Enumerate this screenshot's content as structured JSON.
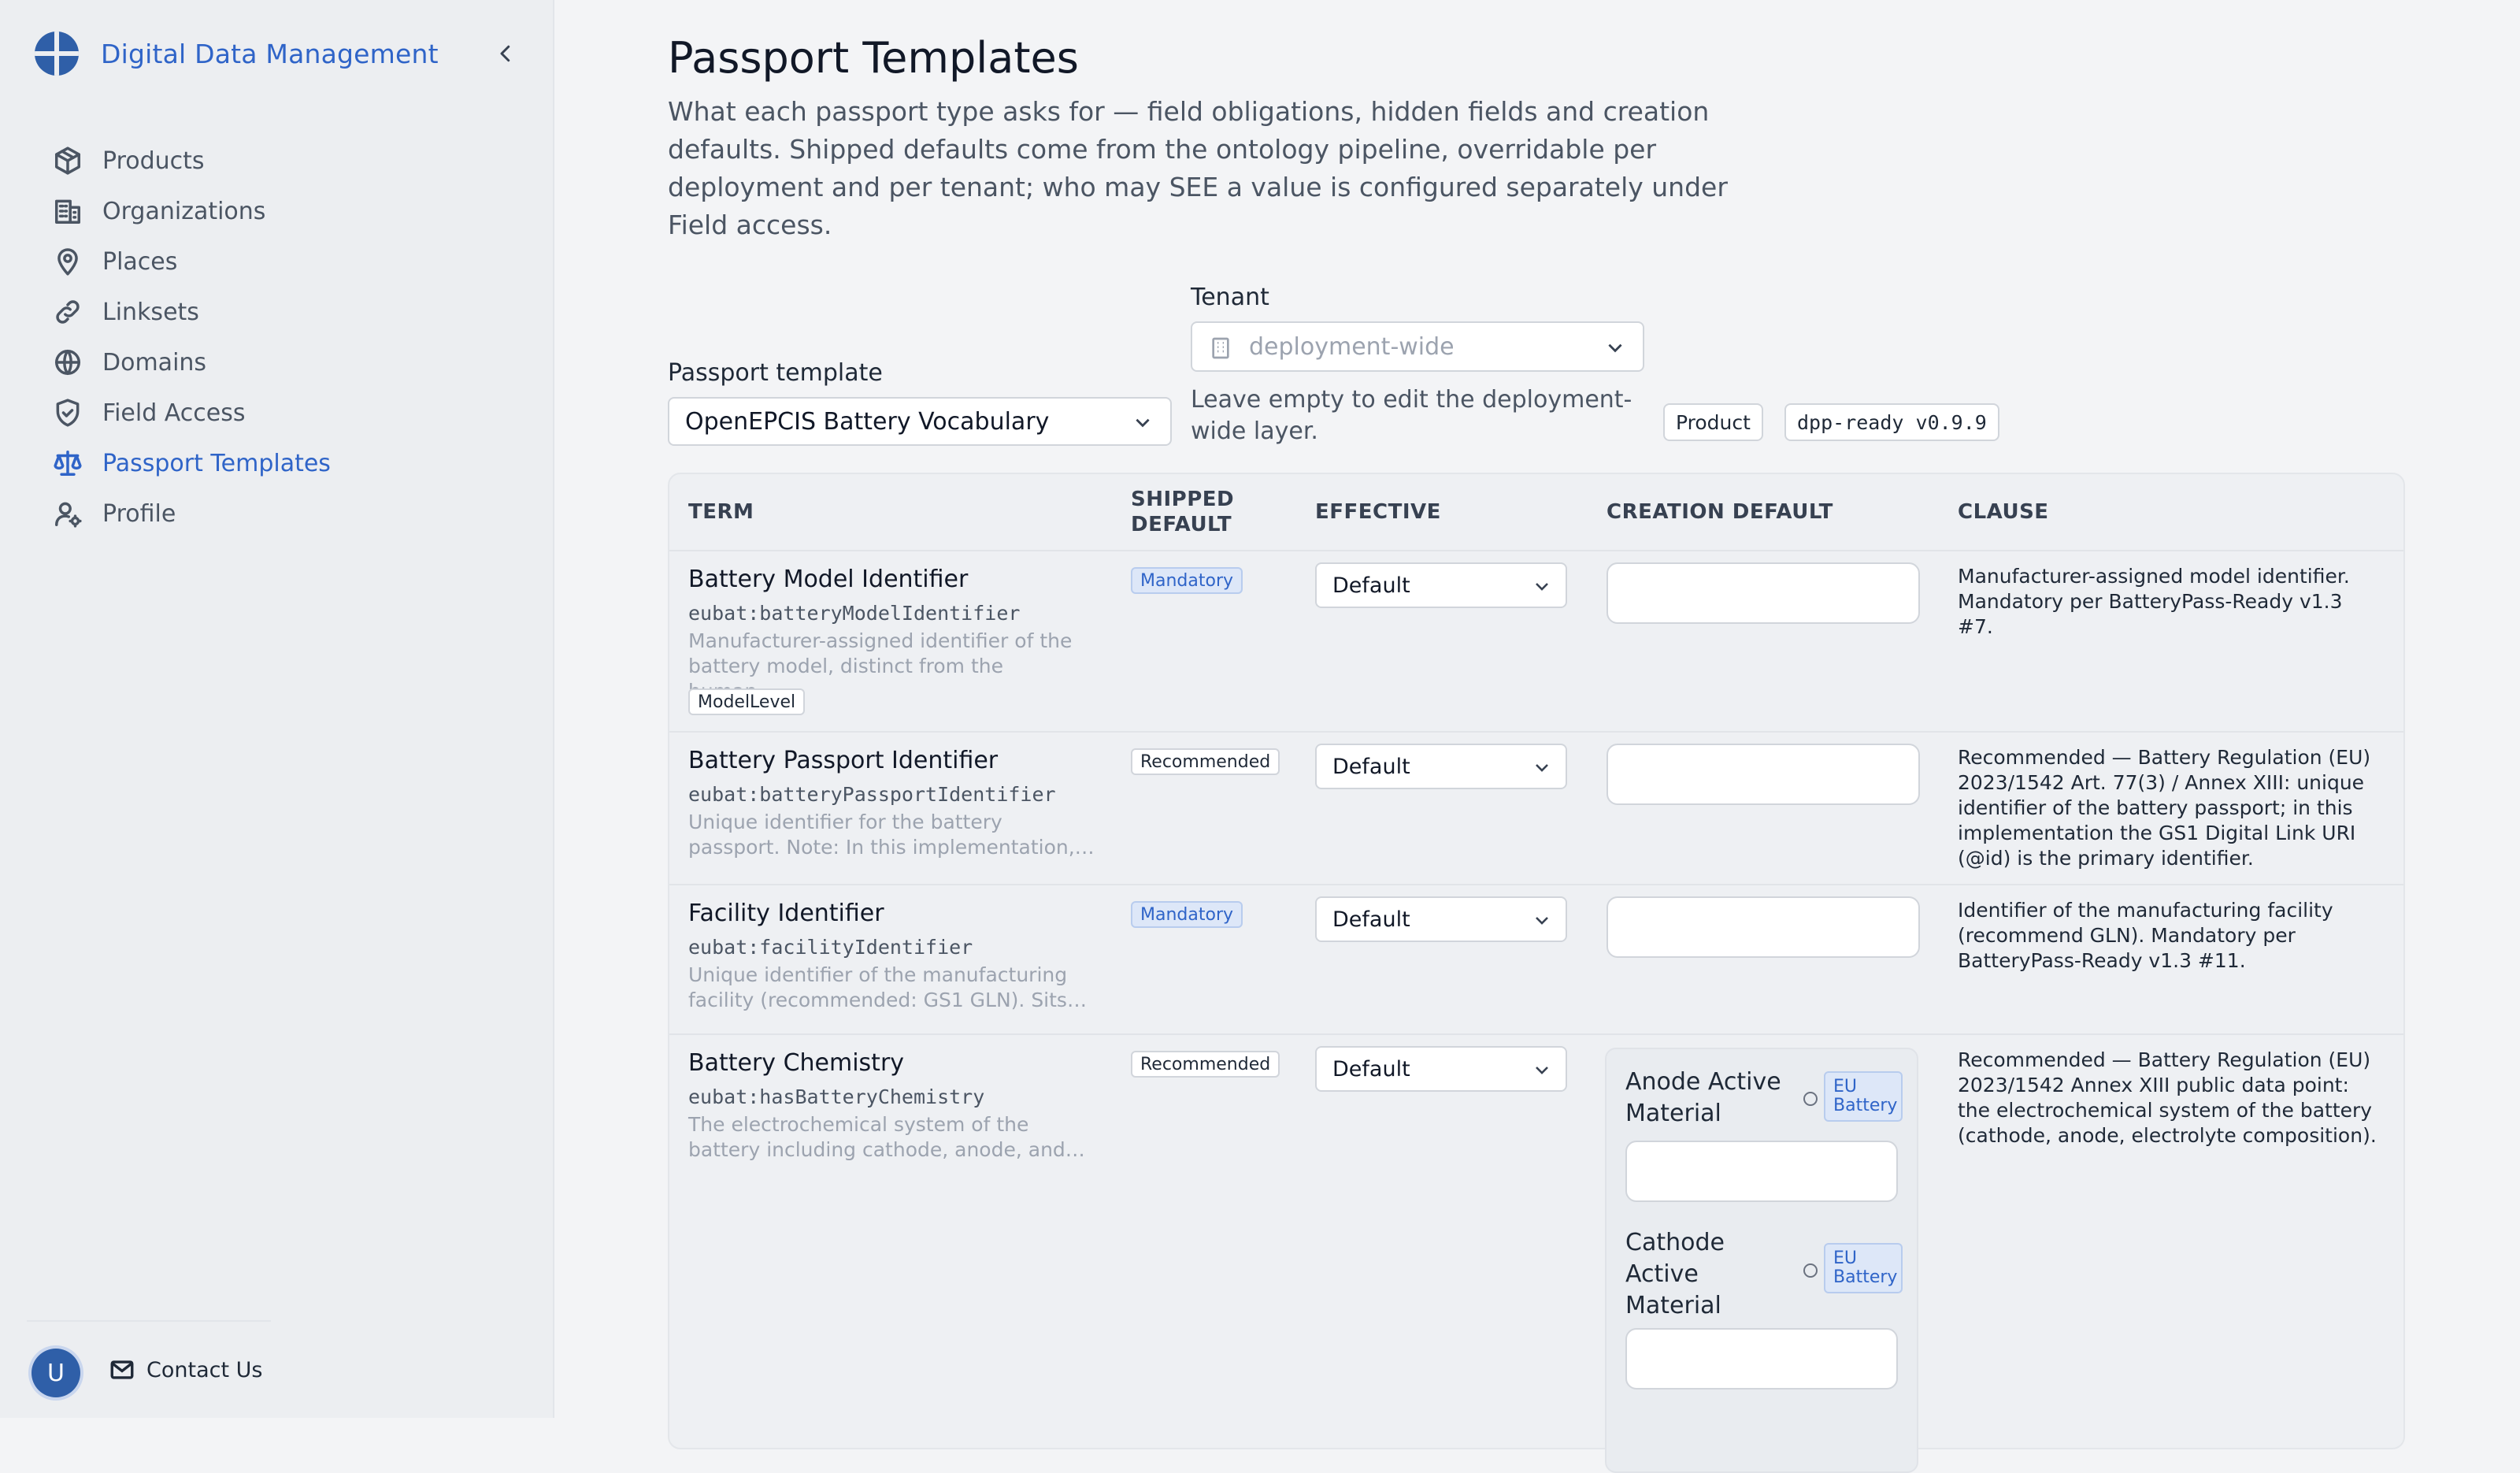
{
  "app": {
    "title": "Digital Data Management"
  },
  "sidebar": {
    "items": [
      {
        "label": "Products",
        "icon": "box-icon"
      },
      {
        "label": "Organizations",
        "icon": "building-icon"
      },
      {
        "label": "Places",
        "icon": "map-pin-icon"
      },
      {
        "label": "Linksets",
        "icon": "link-icon"
      },
      {
        "label": "Domains",
        "icon": "globe-icon"
      },
      {
        "label": "Field Access",
        "icon": "shield-icon"
      },
      {
        "label": "Passport Templates",
        "icon": "scale-icon",
        "active": true
      },
      {
        "label": "Profile",
        "icon": "user-gear-icon"
      }
    ],
    "avatar_initial": "U",
    "contact_label": "Contact Us"
  },
  "page": {
    "title": "Passport Templates",
    "description": "What each passport type asks for — field obligations, hidden fields and creation defaults. Shipped defaults come from the ontology pipeline, overridable per deployment and per tenant; who may SEE a value is configured separately under Field access."
  },
  "filters": {
    "template_label": "Passport template",
    "template_value": "OpenEPCIS Battery Vocabulary",
    "tenant_label": "Tenant",
    "tenant_placeholder": "deployment-wide",
    "tenant_help": "Leave empty to edit the deployment-wide layer.",
    "badge_product": "Product",
    "badge_version": "dpp-ready v0.9.9"
  },
  "table": {
    "headers": {
      "term": "TERM",
      "shipped": "SHIPPED DEFAULT",
      "effective": "EFFECTIVE",
      "creation": "CREATION DEFAULT",
      "clause": "CLAUSE"
    },
    "rows": [
      {
        "name": "Battery Model Identifier",
        "id": "eubat:batteryModelIdentifier",
        "desc": "Manufacturer-assigned identifier of the battery model, distinct from the human…",
        "level_tag": "ModelLevel",
        "shipped": "Mandatory",
        "effective": "Default",
        "clause": "Manufacturer-assigned model identifier. Mandatory per BatteryPass-Ready v1.3 #7."
      },
      {
        "name": "Battery Passport Identifier",
        "id": "eubat:batteryPassportIdentifier",
        "desc": "Unique identifier for the battery passport. Note: In this implementation,…",
        "shipped": "Recommended",
        "effective": "Default",
        "clause": "Recommended — Battery Regulation (EU) 2023/1542 Art. 77(3) / Annex XIII: unique identifier of the battery passport; in this implementation the GS1 Digital Link URI (@id) is the primary identifier."
      },
      {
        "name": "Facility Identifier",
        "id": "eubat:facilityIdentifier",
        "desc": "Unique identifier of the manufacturing facility (recommended: GS1 GLN). Sits…",
        "shipped": "Mandatory",
        "effective": "Default",
        "clause": "Identifier of the manufacturing facility (recommend GLN). Mandatory per BatteryPass-Ready v1.3 #11."
      },
      {
        "name": "Battery Chemistry",
        "id": "eubat:hasBatteryChemistry",
        "desc": "The electrochemical system of the battery including cathode, anode, and…",
        "shipped": "Recommended",
        "effective": "Default",
        "clause": "Recommended — Battery Regulation (EU) 2023/1542 Annex XIII public data point: the electrochemical system of the battery (cathode, anode, electrolyte composition).",
        "nested_fields": [
          {
            "name": "Anode Active Material",
            "tag": "EU Battery"
          },
          {
            "name": "Cathode Active Material",
            "tag": "EU Battery"
          }
        ]
      }
    ]
  }
}
